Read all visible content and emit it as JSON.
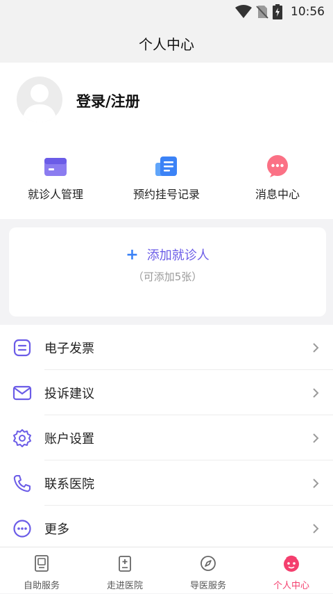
{
  "status_bar": {
    "time": "10:56"
  },
  "header": {
    "title": "个人中心"
  },
  "profile": {
    "login_label": "登录/注册"
  },
  "quick_actions": [
    {
      "label": "就诊人管理",
      "icon": "card-icon"
    },
    {
      "label": "预约挂号记录",
      "icon": "document-icon"
    },
    {
      "label": "消息中心",
      "icon": "chat-bubble-icon"
    }
  ],
  "add_patient": {
    "label": "添加就诊人",
    "hint": "（可添加5张）"
  },
  "menu": [
    {
      "label": "电子发票",
      "icon": "invoice-icon"
    },
    {
      "label": "投诉建议",
      "icon": "mail-icon"
    },
    {
      "label": "账户设置",
      "icon": "gear-icon"
    },
    {
      "label": "联系医院",
      "icon": "phone-icon"
    },
    {
      "label": "更多",
      "icon": "more-icon"
    }
  ],
  "tabs": [
    {
      "label": "自助服务",
      "icon": "kiosk-icon",
      "active": false
    },
    {
      "label": "走进医院",
      "icon": "hospital-icon",
      "active": false
    },
    {
      "label": "导医服务",
      "icon": "compass-icon",
      "active": false
    },
    {
      "label": "个人中心",
      "icon": "profile-face-icon",
      "active": true
    }
  ],
  "colors": {
    "accent_purple": "#6b5ce7",
    "accent_blue": "#3b82f6",
    "active_tab": "#f43f6e"
  }
}
